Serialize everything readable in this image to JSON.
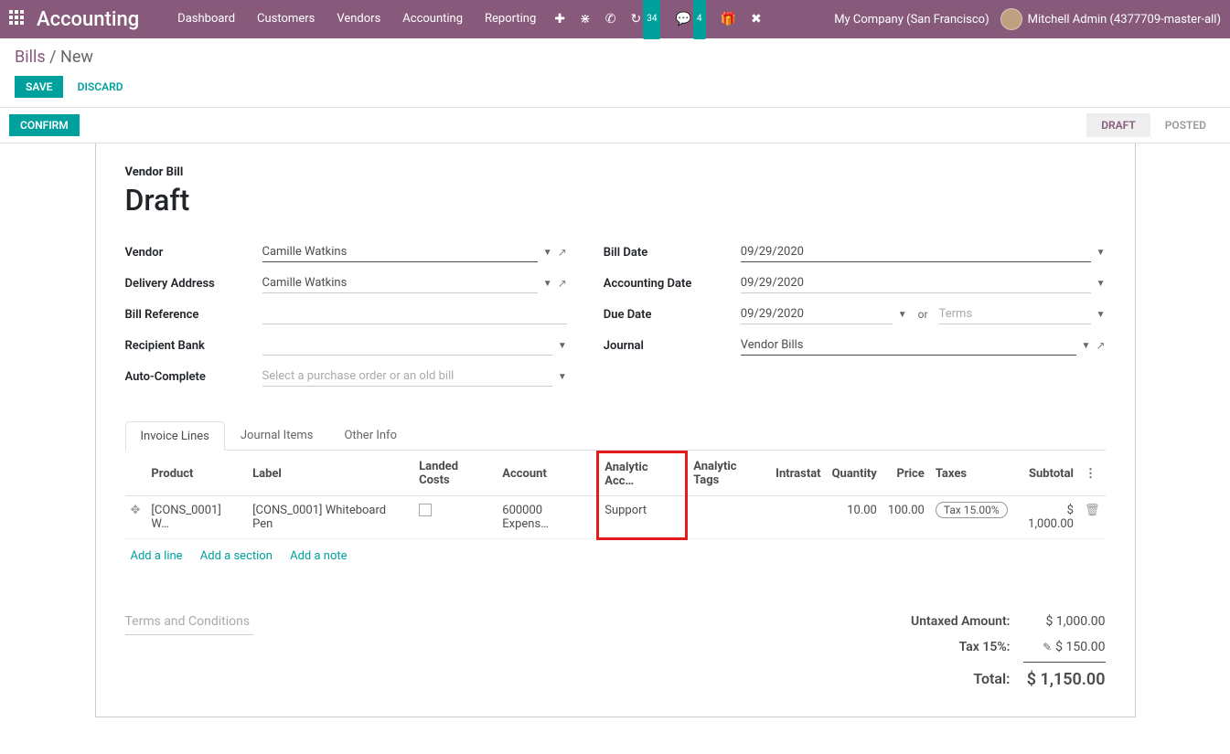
{
  "topnav": {
    "brand": "Accounting",
    "links": [
      "Dashboard",
      "Customers",
      "Vendors",
      "Accounting",
      "Reporting"
    ],
    "badge1": "34",
    "badge2": "4",
    "company": "My Company (San Francisco)",
    "user": "Mitchell Admin (4377709-master-all)"
  },
  "breadcrumb": {
    "root": "Bills",
    "current": "New"
  },
  "buttons": {
    "save": "Save",
    "discard": "Discard",
    "confirm": "Confirm"
  },
  "status": {
    "draft": "Draft",
    "posted": "Posted"
  },
  "form": {
    "type_label": "Vendor Bill",
    "state_label": "Draft",
    "vendor_label": "Vendor",
    "vendor_value": "Camille Watkins",
    "delivery_label": "Delivery Address",
    "delivery_value": "Camille Watkins",
    "billref_label": "Bill Reference",
    "billref_value": "",
    "recipbank_label": "Recipient Bank",
    "recipbank_value": "",
    "autocomplete_label": "Auto-Complete",
    "autocomplete_placeholder": "Select a purchase order or an old bill",
    "billdate_label": "Bill Date",
    "billdate_value": "09/29/2020",
    "acctdate_label": "Accounting Date",
    "acctdate_value": "09/29/2020",
    "duedate_label": "Due Date",
    "duedate_value": "09/29/2020",
    "or": "or",
    "terms_placeholder": "Terms",
    "journal_label": "Journal",
    "journal_value": "Vendor Bills"
  },
  "tabs": {
    "t1": "Invoice Lines",
    "t2": "Journal Items",
    "t3": "Other Info"
  },
  "table": {
    "h_product": "Product",
    "h_label": "Label",
    "h_landed": "Landed Costs",
    "h_account": "Account",
    "h_analytic": "Analytic Acc…",
    "h_antags": "Analytic Tags",
    "h_intrastat": "Intrastat",
    "h_qty": "Quantity",
    "h_price": "Price",
    "h_taxes": "Taxes",
    "h_subtotal": "Subtotal",
    "row": {
      "product": "[CONS_0001] W…",
      "label": "[CONS_0001] Whiteboard Pen",
      "account": "600000 Expens…",
      "analytic": "Support",
      "qty": "10.00",
      "price": "100.00",
      "tax": "Tax 15.00%",
      "subtotal": "$ 1,000.00"
    },
    "add_line": "Add a line",
    "add_section": "Add a section",
    "add_note": "Add a note"
  },
  "footer": {
    "terms_placeholder": "Terms and Conditions",
    "untaxed_label": "Untaxed Amount:",
    "untaxed_val": "$ 1,000.00",
    "tax_label": "Tax 15%:",
    "tax_val": "$ 150.00",
    "total_label": "Total:",
    "total_val": "$ 1,150.00"
  }
}
